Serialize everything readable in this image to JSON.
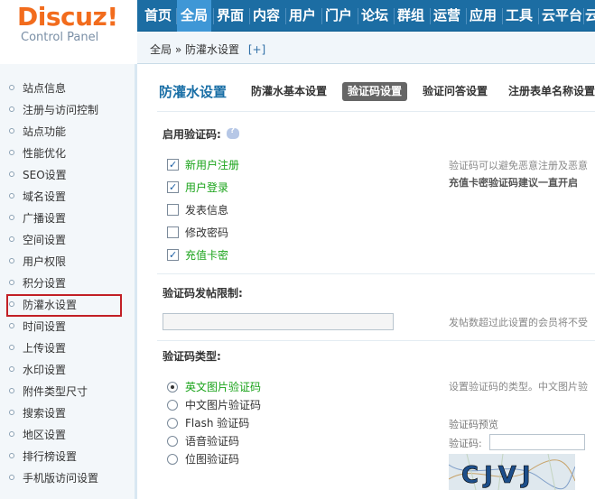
{
  "logo": {
    "brand": "Discuz!",
    "subtitle": "Control Panel"
  },
  "topnav": [
    {
      "label": "首页",
      "active": false
    },
    {
      "label": "全局",
      "active": true
    },
    {
      "label": "界面",
      "active": false
    },
    {
      "label": "内容",
      "active": false
    },
    {
      "label": "用户",
      "active": false
    },
    {
      "label": "门户",
      "active": false
    },
    {
      "label": "论坛",
      "active": false
    },
    {
      "label": "群组",
      "active": false
    },
    {
      "label": "运营",
      "active": false
    },
    {
      "label": "应用",
      "active": false
    },
    {
      "label": "工具",
      "active": false
    },
    {
      "label": "云平台",
      "active": false
    },
    {
      "label": "云",
      "active": false
    }
  ],
  "breadcrumb": {
    "path": "全局 » 防灌水设置",
    "add": "[+]"
  },
  "sidebar": {
    "items": [
      {
        "label": "站点信息"
      },
      {
        "label": "注册与访问控制"
      },
      {
        "label": "站点功能"
      },
      {
        "label": "性能优化"
      },
      {
        "label": "SEO设置"
      },
      {
        "label": "域名设置"
      },
      {
        "label": "广播设置"
      },
      {
        "label": "空间设置"
      },
      {
        "label": "用户权限"
      },
      {
        "label": "积分设置"
      },
      {
        "label": "防灌水设置",
        "active": true
      },
      {
        "label": "时间设置"
      },
      {
        "label": "上传设置"
      },
      {
        "label": "水印设置"
      },
      {
        "label": "附件类型尺寸"
      },
      {
        "label": "搜索设置"
      },
      {
        "label": "地区设置"
      },
      {
        "label": "排行榜设置"
      },
      {
        "label": "手机版访问设置"
      }
    ]
  },
  "main": {
    "title": "防灌水设置",
    "tabs": [
      {
        "label": "防灌水基本设置",
        "current": false
      },
      {
        "label": "验证码设置",
        "current": true
      },
      {
        "label": "验证问答设置",
        "current": false
      },
      {
        "label": "注册表单名称设置",
        "current": false
      }
    ],
    "enable_section": {
      "label": "启用验证码:",
      "options": [
        {
          "label": "新用户注册",
          "checked": true,
          "green": true
        },
        {
          "label": "用户登录",
          "checked": true,
          "green": true
        },
        {
          "label": "发表信息",
          "checked": false,
          "green": false
        },
        {
          "label": "修改密码",
          "checked": false,
          "green": false
        },
        {
          "label": "充值卡密",
          "checked": true,
          "green": true
        }
      ],
      "desc1": "验证码可以避免恶意注册及恶意",
      "desc2": "充值卡密验证码建议一直开启"
    },
    "post_limit": {
      "label": "验证码发帖限制:",
      "value": "",
      "desc": "发帖数超过此设置的会员将不受"
    },
    "type_section": {
      "label": "验证码类型:",
      "options": [
        {
          "label": "英文图片验证码",
          "selected": true
        },
        {
          "label": "中文图片验证码",
          "selected": false
        },
        {
          "label": "Flash 验证码",
          "selected": false
        },
        {
          "label": "语音验证码",
          "selected": false
        },
        {
          "label": "位图验证码",
          "selected": false
        }
      ],
      "desc": "设置验证码的类型。中文图片验",
      "preview_label": "验证码预览",
      "input_label": "验证码:",
      "captcha_text": "CJVJ"
    }
  },
  "colors": {
    "nav_bg": "#1c6da3",
    "nav_active": "#3f97d6",
    "brand_orange": "#f26c1d",
    "title_blue": "#1a6fa6",
    "green_label": "#19a319",
    "active_outline": "#c21f25"
  }
}
